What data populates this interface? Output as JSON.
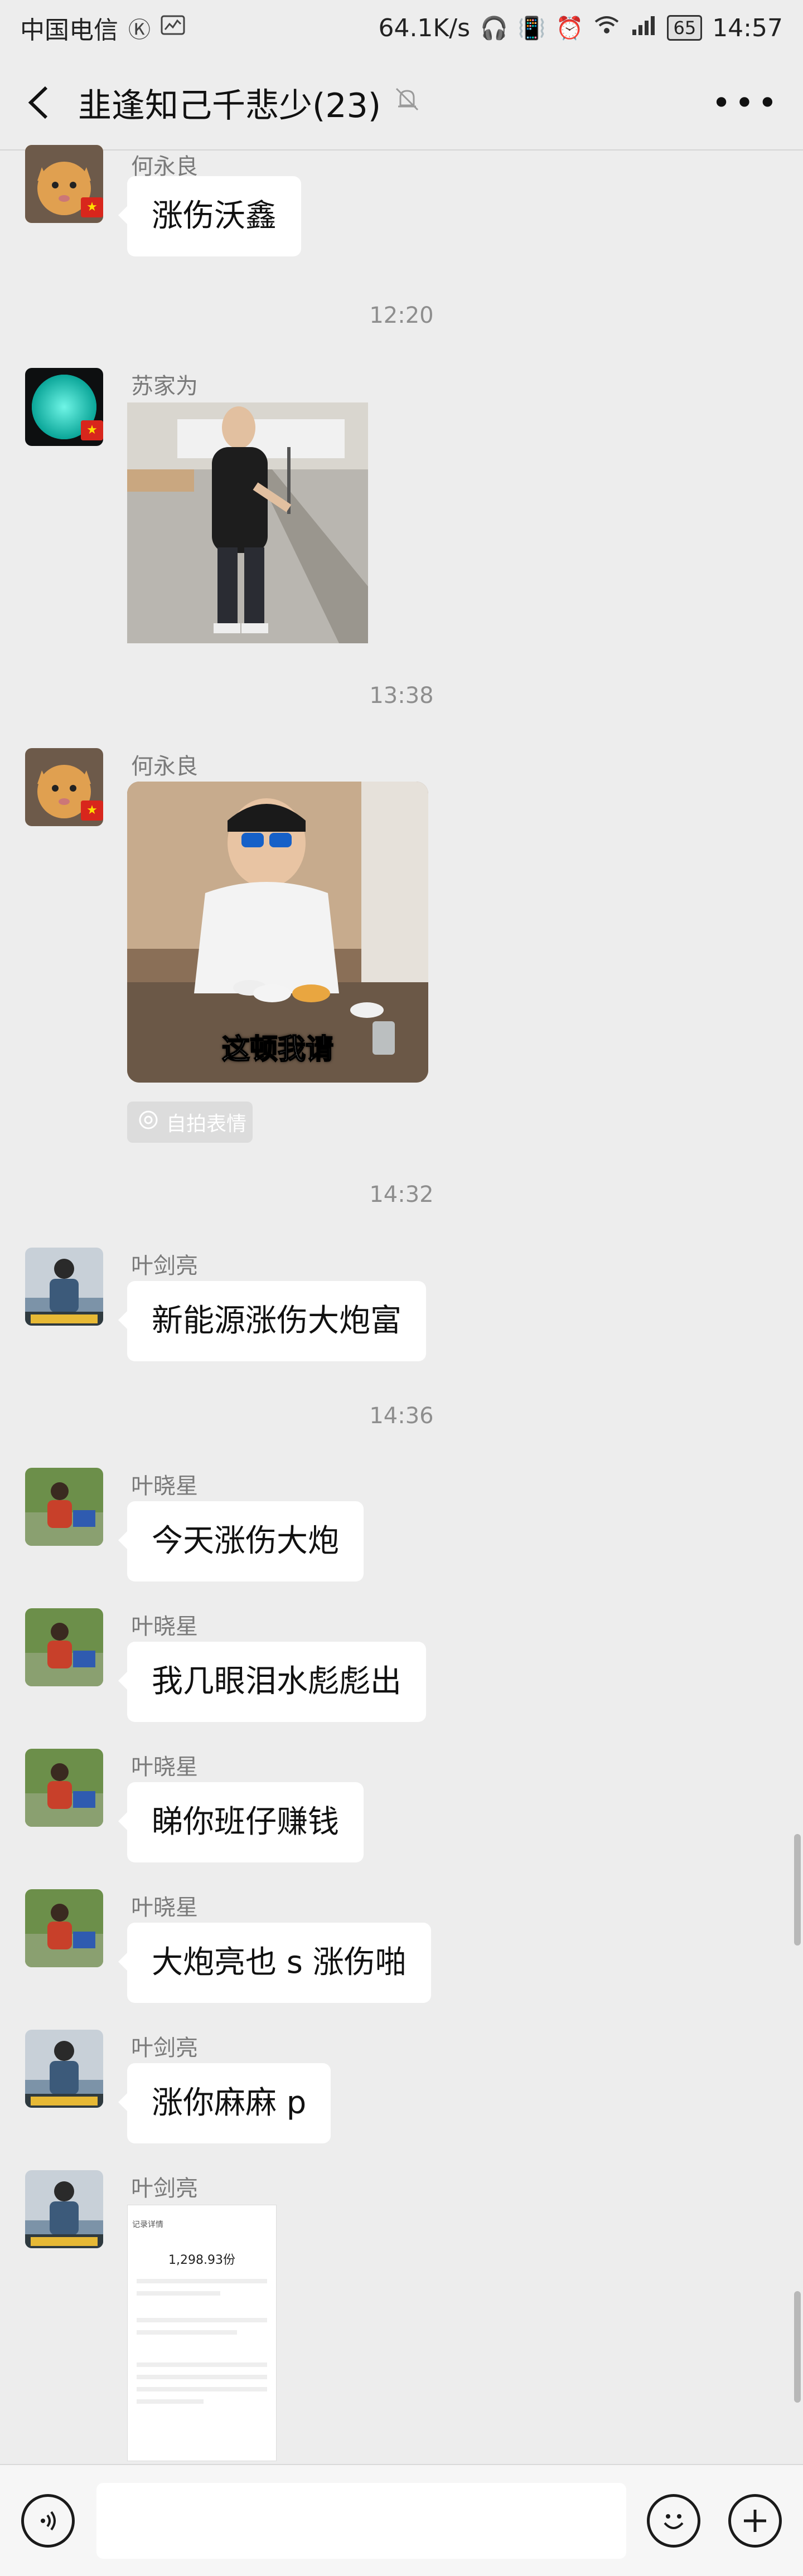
{
  "status_bar": {
    "carrier": "中国电信",
    "speed": "64.1K/s",
    "battery": "65",
    "time": "14:57"
  },
  "header": {
    "title": "韭逢知己千悲少(23)"
  },
  "chat": {
    "times": [
      "12:20",
      "13:38",
      "14:32",
      "14:36"
    ],
    "messages": [
      {
        "sender": "何永良",
        "text": "涨伤沃鑫"
      },
      {
        "sender": "苏家为",
        "type": "image"
      },
      {
        "sender": "何永良",
        "type": "image",
        "caption": "这顿我请",
        "tag": "自拍表情"
      },
      {
        "sender": "叶剑亮",
        "text": "新能源涨伤大炮富"
      },
      {
        "sender": "叶晓星",
        "text": "今天涨伤大炮"
      },
      {
        "sender": "叶晓星",
        "text": "我几眼泪水彪彪出"
      },
      {
        "sender": "叶晓星",
        "text": "睇你班仔赚钱"
      },
      {
        "sender": "叶晓星",
        "text": "大炮亮也 s 涨伤啪"
      },
      {
        "sender": "叶剑亮",
        "text": "涨你麻麻 p"
      },
      {
        "sender": "叶剑亮",
        "type": "screenshot",
        "screenshot": {
          "title": "记录详情",
          "amount": "1,298.93份"
        }
      }
    ]
  },
  "input": {
    "placeholder": ""
  },
  "colors": {
    "bg": "#ededed",
    "bubble": "#ffffff",
    "flag": "#d8261c"
  }
}
